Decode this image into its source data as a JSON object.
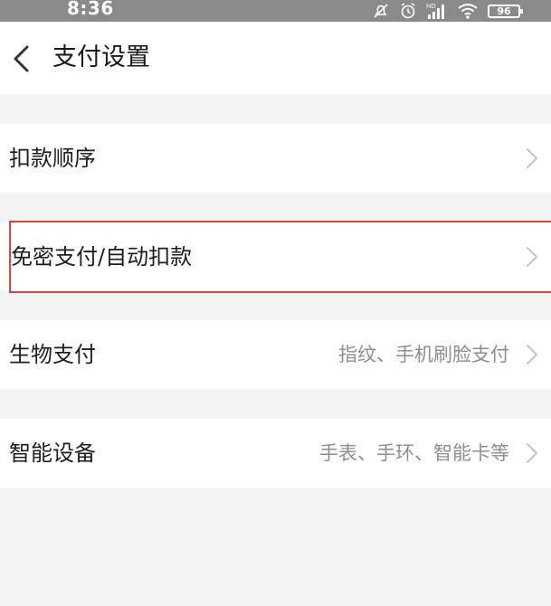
{
  "status_bar": {
    "time": "8:36",
    "battery": "96",
    "icons": [
      "alarm-off-icon",
      "alarm-icon",
      "signal-icon",
      "wifi-icon",
      "battery-icon"
    ]
  },
  "header": {
    "title": "支付设置",
    "back_icon": "chevron-left-icon"
  },
  "rows": [
    {
      "label": "扣款顺序",
      "value": ""
    },
    {
      "label": "免密支付/自动扣款",
      "value": ""
    },
    {
      "label": "生物支付",
      "value": "指纹、手机刷脸支付"
    },
    {
      "label": "智能设备",
      "value": "手表、手环、智能卡等"
    }
  ],
  "colors": {
    "status_bar": "#8a8a8a",
    "background": "#f4f4f4",
    "highlight": "#d9463a",
    "secondary_text": "#8e8e8e"
  }
}
